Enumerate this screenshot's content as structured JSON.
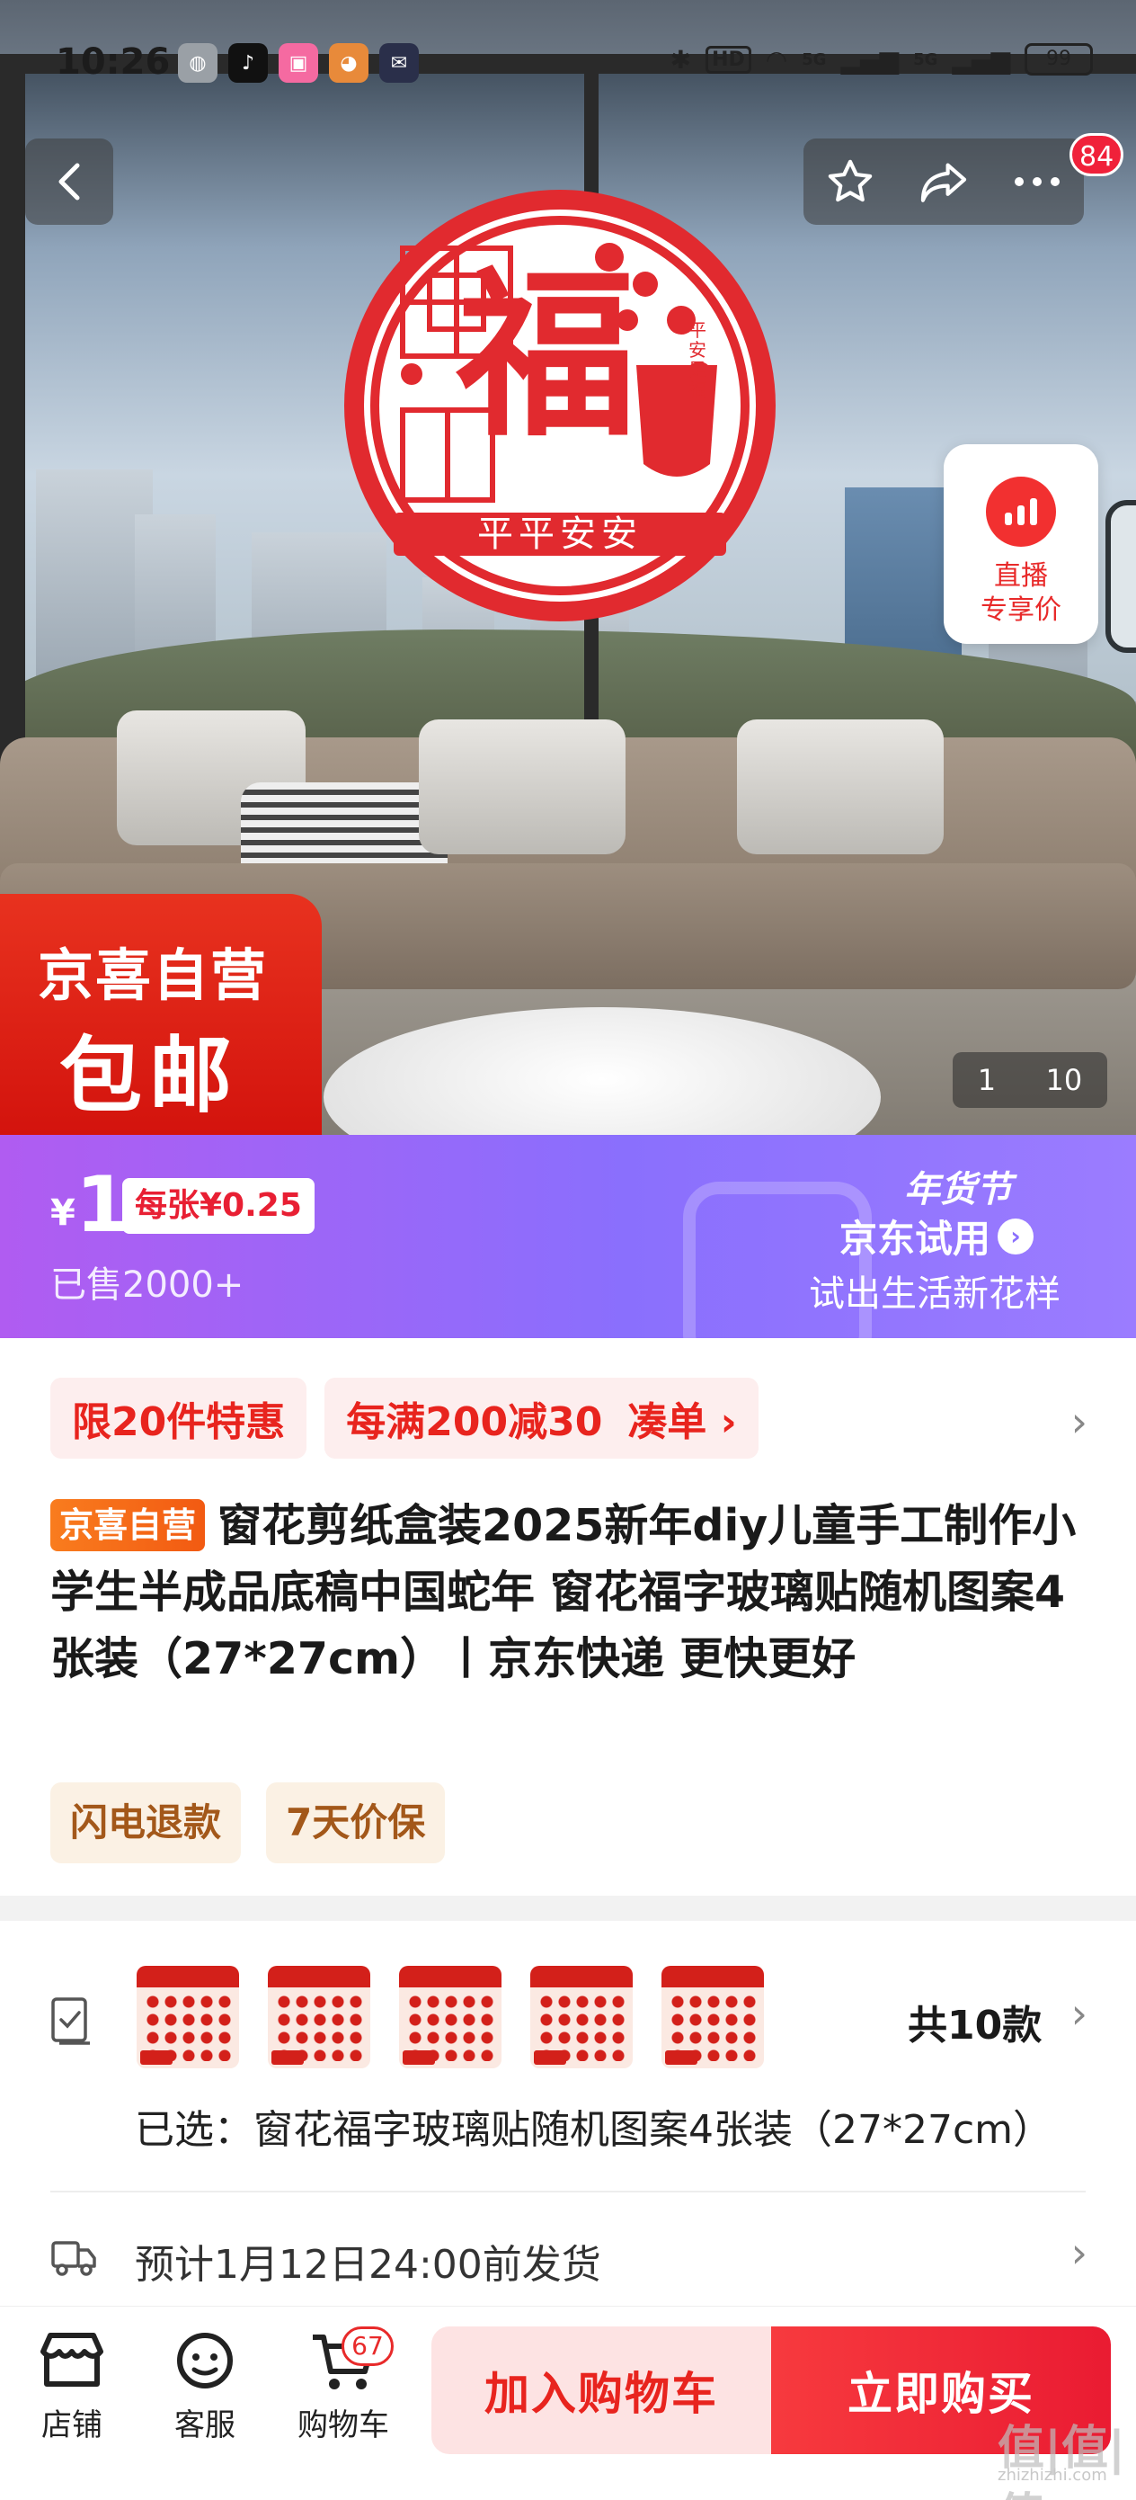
{
  "status_bar": {
    "time": "10:26",
    "network": "HD",
    "signal1": "5G",
    "signal2": "5G",
    "battery": "99"
  },
  "hero": {
    "fu_character": "福",
    "fu_blessing": "平平安安",
    "vase_text": "平安是福",
    "live_line1": "直播",
    "live_line2": "专享价",
    "badge_line1": "京喜自营",
    "badge_line2": "包邮",
    "counter_current": "1",
    "counter_total": "10",
    "more_badge": "84"
  },
  "price": {
    "currency": "¥",
    "amount": "1",
    "unit_price": "每张¥0.25",
    "sold": "已售2000+",
    "festival": "年货节",
    "trial": "京东试用",
    "slogan": "试出生活新花样"
  },
  "promos": [
    "限20件特惠",
    "每满200减30",
    "凑单"
  ],
  "product": {
    "store_tag": "京喜自营",
    "title": "窗花剪纸盒装2025新年diy儿童手工制作小学生半成品底稿中国蛇年 窗花福字玻璃贴随机图案4张装（27*27cm）丨京东快递 更快更好",
    "services": [
      "闪电退款",
      "7天价保"
    ]
  },
  "spec": {
    "count": "共10款",
    "selected": "已选：窗花福字玻璃贴随机图案4张装（27*27cm）",
    "shipping": "预计1月12日24:00前发货"
  },
  "bottom_bar": {
    "store": "店铺",
    "service": "客服",
    "cart": "购物车",
    "cart_count": "67",
    "add_to_cart": "加入购物车",
    "buy_now": "立即购买"
  },
  "watermark": "值|值|值",
  "watermark_url": "zhizhizhi.com",
  "colors": {
    "accent_red": "#e8241e",
    "price_banner_start": "#b05cf1",
    "price_banner_end": "#9b7cff",
    "tag_orange": "#f25a12"
  }
}
